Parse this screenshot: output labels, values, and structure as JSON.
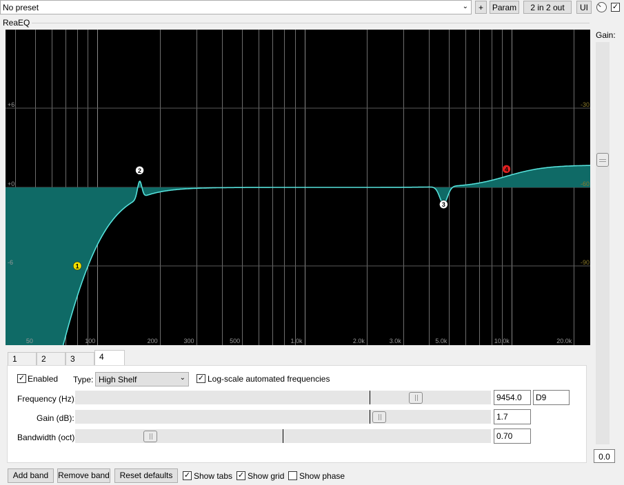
{
  "toolbar": {
    "preset": "No preset",
    "plus_label": "+",
    "param_label": "Param",
    "io_label": "2 in 2 out",
    "ui_label": "UI"
  },
  "plugin_name": "ReaEQ",
  "gain_slider": {
    "label": "Gain:",
    "value": "0.0"
  },
  "graph": {
    "db_labels": [
      "+6",
      "+0",
      "-6"
    ],
    "right_labels": [
      "-30",
      "-60",
      "-90"
    ],
    "freq_labels": [
      "50",
      "100",
      "200",
      "300",
      "500",
      "1.0k",
      "2.0k",
      "3.0k",
      "5.0k",
      "10.0k",
      "20.0k"
    ],
    "band_markers": [
      {
        "label": "1",
        "color": "#f0e000",
        "freq_hz": 80,
        "gain_db": -6.0
      },
      {
        "label": "2",
        "color": "#ffffff",
        "freq_hz": 160,
        "gain_db": 1.3
      },
      {
        "label": "3",
        "color": "#ffffff",
        "freq_hz": 4700,
        "gain_db": -1.3
      },
      {
        "label": "4",
        "color": "#e02020",
        "freq_hz": 9454,
        "gain_db": 1.4
      }
    ]
  },
  "tabs": [
    "1",
    "2",
    "3",
    "4"
  ],
  "active_tab": "4",
  "band": {
    "enabled_label": "Enabled",
    "enabled": true,
    "type_label": "Type:",
    "type_value": "High Shelf",
    "logscale_label": "Log-scale automated frequencies",
    "logscale": true,
    "frequency": {
      "label": "Frequency (Hz):",
      "value": "9454.0",
      "note": "D9",
      "level": 0.83
    },
    "gain": {
      "label": "Gain (dB):",
      "value": "1.7",
      "level": 0.74
    },
    "bandwidth": {
      "label": "Bandwidth (oct):",
      "value": "0.70",
      "level": 0.17
    }
  },
  "bottom": {
    "add_band": "Add band",
    "remove_band": "Remove band",
    "reset_defaults": "Reset defaults",
    "show_tabs": "Show tabs",
    "show_tabs_checked": true,
    "show_grid": "Show grid",
    "show_grid_checked": true,
    "show_phase": "Show phase",
    "show_phase_checked": false
  }
}
